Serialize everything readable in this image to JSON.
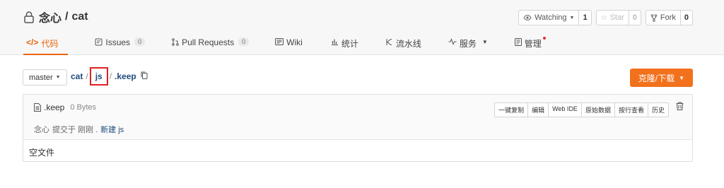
{
  "repo": {
    "owner": "念心",
    "separator": "/",
    "name": "cat"
  },
  "actions": [
    {
      "label": "Watching",
      "count": "1"
    },
    {
      "label": "Star",
      "count": "0"
    },
    {
      "label": "Fork",
      "count": "0"
    }
  ],
  "tabs": [
    {
      "label": "代码"
    },
    {
      "label": "Issues",
      "badge": "0"
    },
    {
      "label": "Pull Requests",
      "badge": "0"
    },
    {
      "label": "Wiki"
    },
    {
      "label": "统计"
    },
    {
      "label": "流水线"
    },
    {
      "label": "服务"
    },
    {
      "label": "管理"
    }
  ],
  "branch": {
    "label": "master"
  },
  "breadcrumb": {
    "root": "cat",
    "sep1": "/",
    "dir": "js",
    "sep2": "/",
    "file": ".keep"
  },
  "clone": {
    "label": "克隆/下载"
  },
  "file": {
    "name": ".keep",
    "size": "0 Bytes",
    "tools": [
      "一键复制",
      "编辑",
      "Web IDE",
      "原始数据",
      "按行查看",
      "历史"
    ],
    "commit": {
      "author": "念心",
      "text": "提交于 刚刚 .",
      "message": "新建 js"
    },
    "content": "空文件"
  },
  "colors": {
    "accent": "#e8650a",
    "clone_button": "#f2711c",
    "link": "#1f4b7a",
    "highlight_box": "#e02020"
  }
}
